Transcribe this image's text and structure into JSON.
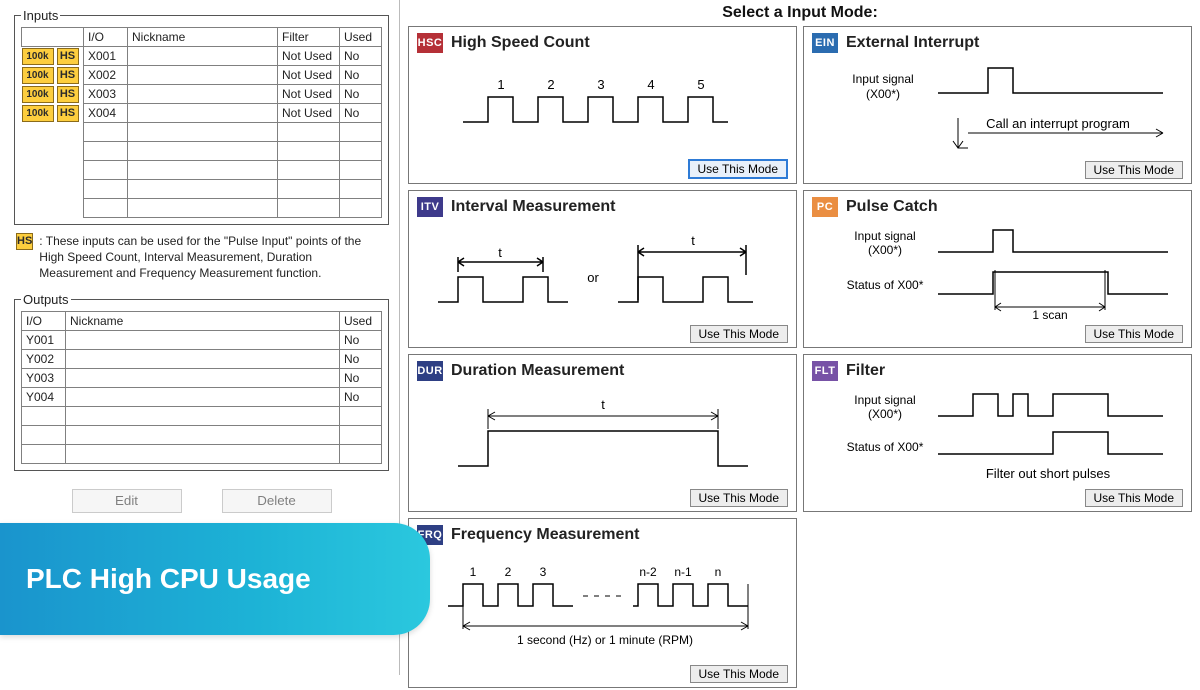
{
  "header_right": "Select a Input Mode:",
  "inputs": {
    "legend": "Inputs",
    "cols": [
      "I/O",
      "Nickname",
      "Filter",
      "Used"
    ],
    "rows": [
      {
        "prefix100k": "100k",
        "prefixHS": "HS",
        "io": "X001",
        "nick": "",
        "filter": "Not Used",
        "used": "No"
      },
      {
        "prefix100k": "100k",
        "prefixHS": "HS",
        "io": "X002",
        "nick": "",
        "filter": "Not Used",
        "used": "No"
      },
      {
        "prefix100k": "100k",
        "prefixHS": "HS",
        "io": "X003",
        "nick": "",
        "filter": "Not Used",
        "used": "No"
      },
      {
        "prefix100k": "100k",
        "prefixHS": "HS",
        "io": "X004",
        "nick": "",
        "filter": "Not Used",
        "used": "No"
      }
    ],
    "blank_rows": 5
  },
  "hs_note_prefix": "HS",
  "hs_note_text": ": These inputs can be used for the \"Pulse Input\" points of the High Speed Count, Interval Measurement, Duration Measurement and Frequency Measurement function.",
  "outputs": {
    "legend": "Outputs",
    "cols": [
      "I/O",
      "Nickname",
      "Used"
    ],
    "rows": [
      {
        "io": "Y001",
        "nick": "",
        "used": "No"
      },
      {
        "io": "Y002",
        "nick": "",
        "used": "No"
      },
      {
        "io": "Y003",
        "nick": "",
        "used": "No"
      },
      {
        "io": "Y004",
        "nick": "",
        "used": "No"
      }
    ],
    "blank_rows": 3
  },
  "left_buttons": {
    "edit": "Edit",
    "delete": "Delete"
  },
  "use_label": "Use This Mode",
  "modes": {
    "hsc": {
      "badge": "HSC",
      "title": "High Speed Count",
      "nums": [
        "1",
        "2",
        "3",
        "4",
        "5"
      ],
      "active": true
    },
    "ein": {
      "badge": "EIN",
      "title": "External Interrupt",
      "sig": "Input signal",
      "sig2": "(X00*)",
      "note": "Call an interrupt program"
    },
    "itv": {
      "badge": "ITV",
      "title": "Interval Measurement",
      "t": "t",
      "or": "or"
    },
    "pc": {
      "badge": "PC",
      "title": "Pulse Catch",
      "sig": "Input signal",
      "sig2": "(X00*)",
      "stat": "Status of X00*",
      "scan": "1 scan"
    },
    "dur": {
      "badge": "DUR",
      "title": "Duration Measurement",
      "t": "t"
    },
    "flt": {
      "badge": "FLT",
      "title": "Filter",
      "sig": "Input signal",
      "sig2": "(X00*)",
      "stat": "Status of X00*",
      "note": "Filter out short pulses"
    },
    "frq": {
      "badge": "FRQ",
      "title": "Frequency Measurement",
      "nums": [
        "1",
        "2",
        "3",
        "n-2",
        "n-1",
        "n"
      ],
      "note": "1 second (Hz) or 1 minute (RPM)"
    }
  },
  "banner": "PLC High CPU Usage"
}
